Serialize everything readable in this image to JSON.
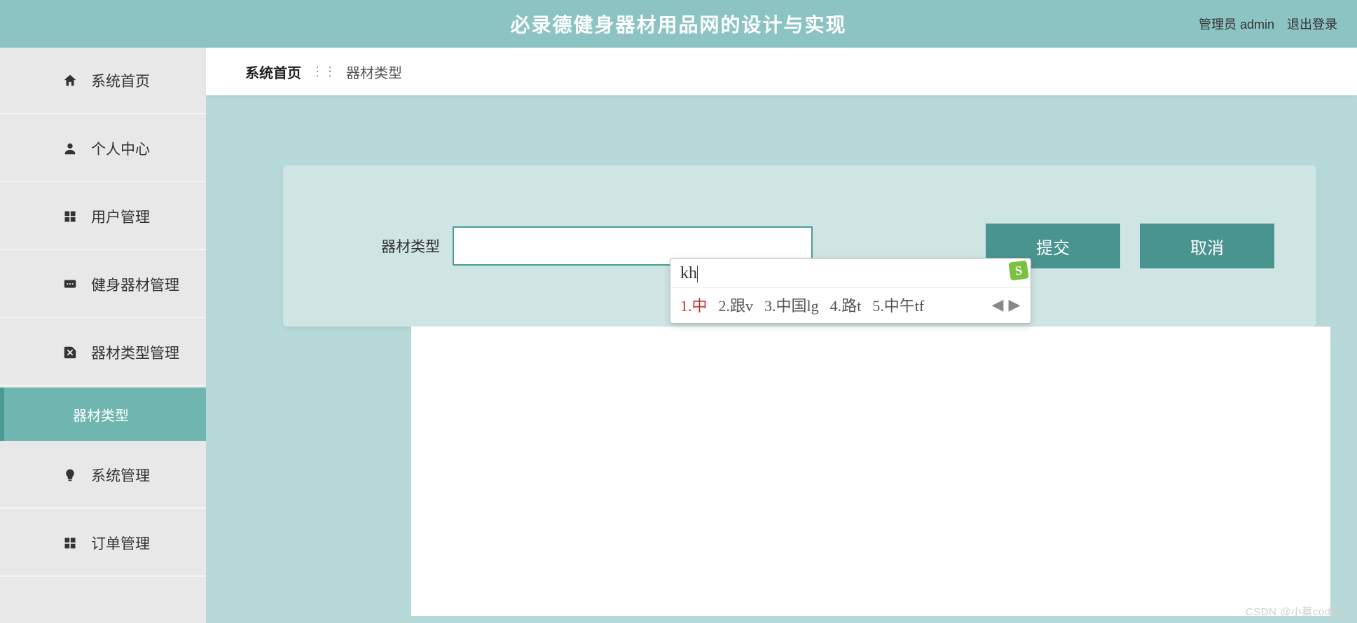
{
  "header": {
    "title": "必录德健身器材用品网的设计与实现",
    "admin_label": "管理员 admin",
    "logout_label": "退出登录"
  },
  "sidebar": {
    "items": [
      {
        "label": "系统首页",
        "icon": "home"
      },
      {
        "label": "个人中心",
        "icon": "person"
      },
      {
        "label": "用户管理",
        "icon": "grid"
      },
      {
        "label": "健身器材管理",
        "icon": "chat"
      },
      {
        "label": "器材类型管理",
        "icon": "tag"
      },
      {
        "label": "系统管理",
        "icon": "bulb"
      },
      {
        "label": "订单管理",
        "icon": "grid"
      }
    ],
    "sub_active": {
      "label": "器材类型"
    }
  },
  "breadcrumb": {
    "home": "系统首页",
    "current": "器材类型"
  },
  "form": {
    "label": "器材类型",
    "value": "",
    "submit": "提交",
    "cancel": "取消"
  },
  "ime": {
    "input": "kh",
    "logo": "S",
    "candidates": [
      "1.中",
      "2.跟v",
      "3.中国lg",
      "4.路t",
      "5.中午tf"
    ]
  },
  "watermark": "CSDN @小蔡coding"
}
